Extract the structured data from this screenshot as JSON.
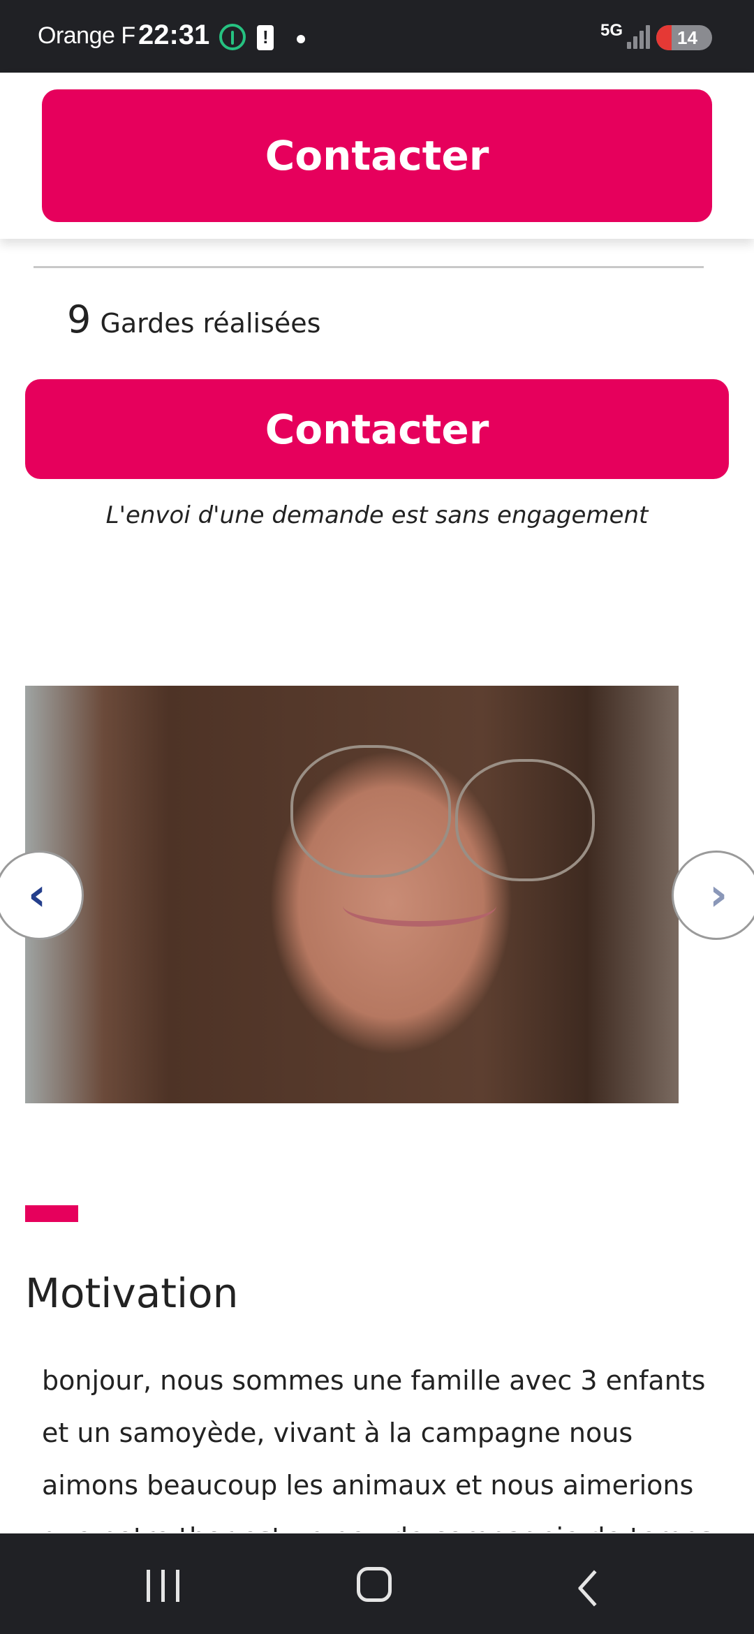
{
  "status_bar": {
    "carrier": "Orange F",
    "time": "22:31",
    "network": "5G",
    "battery": "14",
    "icons": [
      "leaf-icon",
      "battery-alert-icon",
      "dot-icon",
      "signal-icon",
      "battery-icon"
    ]
  },
  "sticky_header": {
    "contact_label": "Contacter"
  },
  "profile": {
    "gardes_count": "9",
    "gardes_label": "Gardes réalisées",
    "contact_label": "Contacter",
    "disclaimer": "L'envoi d'une demande est sans engagement"
  },
  "carousel": {
    "prev_icon": "chevron-left-icon",
    "next_icon": "chevron-right-icon",
    "prev_glyph": "‹",
    "next_glyph": "›"
  },
  "motivation": {
    "title": "Motivation",
    "text": "bonjour, nous sommes une famille avec 3 enfants et un samoyède, vivant à la campagne nous aimons beaucoup les animaux et nous aimerions que notre thor est un peu de compagnie de temps en temps, il"
  },
  "colors": {
    "brand": "#e6005c",
    "arrow_prev": "#243f8c",
    "arrow_next": "#8a97b8",
    "system_bars": "#202125"
  },
  "nav_bar": {
    "icons": [
      "recents-icon",
      "home-icon",
      "back-icon"
    ]
  }
}
